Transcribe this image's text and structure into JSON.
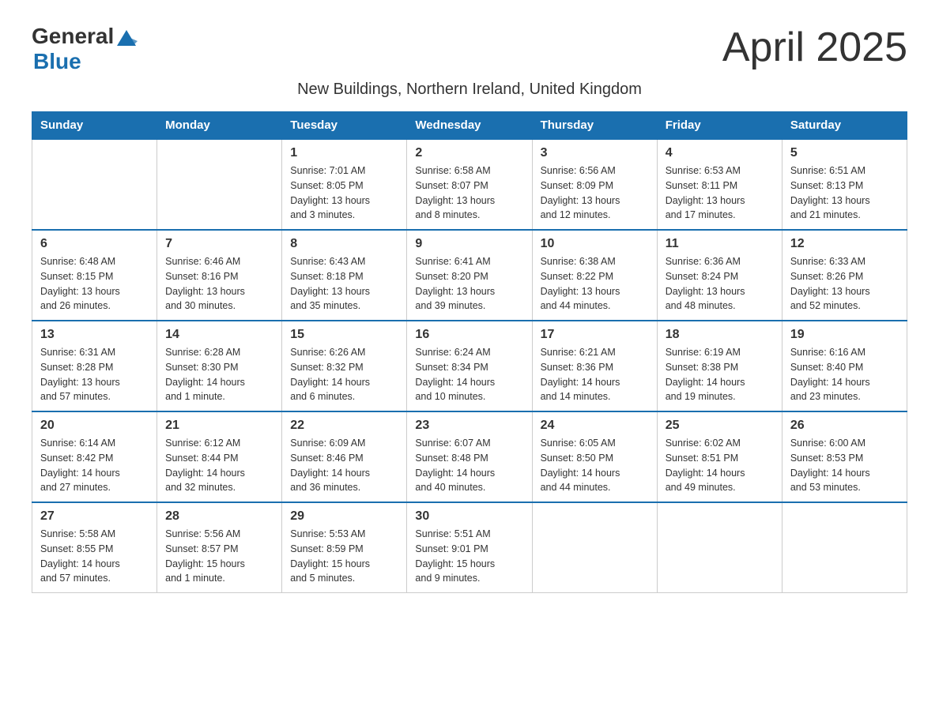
{
  "header": {
    "logo_general": "General",
    "logo_blue": "Blue",
    "title": "April 2025",
    "subtitle": "New Buildings, Northern Ireland, United Kingdom"
  },
  "weekdays": [
    "Sunday",
    "Monday",
    "Tuesday",
    "Wednesday",
    "Thursday",
    "Friday",
    "Saturday"
  ],
  "weeks": [
    [
      {
        "day": "",
        "info": ""
      },
      {
        "day": "",
        "info": ""
      },
      {
        "day": "1",
        "info": "Sunrise: 7:01 AM\nSunset: 8:05 PM\nDaylight: 13 hours\nand 3 minutes."
      },
      {
        "day": "2",
        "info": "Sunrise: 6:58 AM\nSunset: 8:07 PM\nDaylight: 13 hours\nand 8 minutes."
      },
      {
        "day": "3",
        "info": "Sunrise: 6:56 AM\nSunset: 8:09 PM\nDaylight: 13 hours\nand 12 minutes."
      },
      {
        "day": "4",
        "info": "Sunrise: 6:53 AM\nSunset: 8:11 PM\nDaylight: 13 hours\nand 17 minutes."
      },
      {
        "day": "5",
        "info": "Sunrise: 6:51 AM\nSunset: 8:13 PM\nDaylight: 13 hours\nand 21 minutes."
      }
    ],
    [
      {
        "day": "6",
        "info": "Sunrise: 6:48 AM\nSunset: 8:15 PM\nDaylight: 13 hours\nand 26 minutes."
      },
      {
        "day": "7",
        "info": "Sunrise: 6:46 AM\nSunset: 8:16 PM\nDaylight: 13 hours\nand 30 minutes."
      },
      {
        "day": "8",
        "info": "Sunrise: 6:43 AM\nSunset: 8:18 PM\nDaylight: 13 hours\nand 35 minutes."
      },
      {
        "day": "9",
        "info": "Sunrise: 6:41 AM\nSunset: 8:20 PM\nDaylight: 13 hours\nand 39 minutes."
      },
      {
        "day": "10",
        "info": "Sunrise: 6:38 AM\nSunset: 8:22 PM\nDaylight: 13 hours\nand 44 minutes."
      },
      {
        "day": "11",
        "info": "Sunrise: 6:36 AM\nSunset: 8:24 PM\nDaylight: 13 hours\nand 48 minutes."
      },
      {
        "day": "12",
        "info": "Sunrise: 6:33 AM\nSunset: 8:26 PM\nDaylight: 13 hours\nand 52 minutes."
      }
    ],
    [
      {
        "day": "13",
        "info": "Sunrise: 6:31 AM\nSunset: 8:28 PM\nDaylight: 13 hours\nand 57 minutes."
      },
      {
        "day": "14",
        "info": "Sunrise: 6:28 AM\nSunset: 8:30 PM\nDaylight: 14 hours\nand 1 minute."
      },
      {
        "day": "15",
        "info": "Sunrise: 6:26 AM\nSunset: 8:32 PM\nDaylight: 14 hours\nand 6 minutes."
      },
      {
        "day": "16",
        "info": "Sunrise: 6:24 AM\nSunset: 8:34 PM\nDaylight: 14 hours\nand 10 minutes."
      },
      {
        "day": "17",
        "info": "Sunrise: 6:21 AM\nSunset: 8:36 PM\nDaylight: 14 hours\nand 14 minutes."
      },
      {
        "day": "18",
        "info": "Sunrise: 6:19 AM\nSunset: 8:38 PM\nDaylight: 14 hours\nand 19 minutes."
      },
      {
        "day": "19",
        "info": "Sunrise: 6:16 AM\nSunset: 8:40 PM\nDaylight: 14 hours\nand 23 minutes."
      }
    ],
    [
      {
        "day": "20",
        "info": "Sunrise: 6:14 AM\nSunset: 8:42 PM\nDaylight: 14 hours\nand 27 minutes."
      },
      {
        "day": "21",
        "info": "Sunrise: 6:12 AM\nSunset: 8:44 PM\nDaylight: 14 hours\nand 32 minutes."
      },
      {
        "day": "22",
        "info": "Sunrise: 6:09 AM\nSunset: 8:46 PM\nDaylight: 14 hours\nand 36 minutes."
      },
      {
        "day": "23",
        "info": "Sunrise: 6:07 AM\nSunset: 8:48 PM\nDaylight: 14 hours\nand 40 minutes."
      },
      {
        "day": "24",
        "info": "Sunrise: 6:05 AM\nSunset: 8:50 PM\nDaylight: 14 hours\nand 44 minutes."
      },
      {
        "day": "25",
        "info": "Sunrise: 6:02 AM\nSunset: 8:51 PM\nDaylight: 14 hours\nand 49 minutes."
      },
      {
        "day": "26",
        "info": "Sunrise: 6:00 AM\nSunset: 8:53 PM\nDaylight: 14 hours\nand 53 minutes."
      }
    ],
    [
      {
        "day": "27",
        "info": "Sunrise: 5:58 AM\nSunset: 8:55 PM\nDaylight: 14 hours\nand 57 minutes."
      },
      {
        "day": "28",
        "info": "Sunrise: 5:56 AM\nSunset: 8:57 PM\nDaylight: 15 hours\nand 1 minute."
      },
      {
        "day": "29",
        "info": "Sunrise: 5:53 AM\nSunset: 8:59 PM\nDaylight: 15 hours\nand 5 minutes."
      },
      {
        "day": "30",
        "info": "Sunrise: 5:51 AM\nSunset: 9:01 PM\nDaylight: 15 hours\nand 9 minutes."
      },
      {
        "day": "",
        "info": ""
      },
      {
        "day": "",
        "info": ""
      },
      {
        "day": "",
        "info": ""
      }
    ]
  ]
}
